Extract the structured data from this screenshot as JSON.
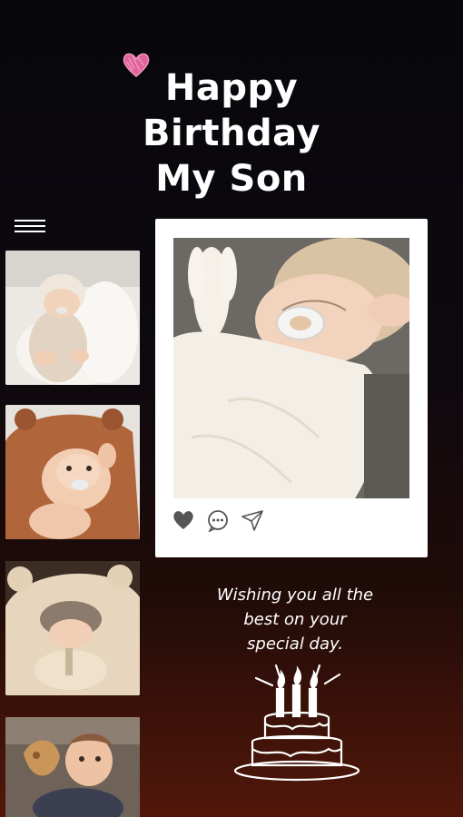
{
  "header": {
    "title_lines": [
      "Happy",
      "Birthday",
      "My Son"
    ],
    "decoration_icon": "pink-heart-icon"
  },
  "sidebar": {
    "menu_icon": "hamburger-menu-icon",
    "thumbnails": [
      {
        "icon": "baby-photo-1"
      },
      {
        "icon": "baby-photo-2"
      },
      {
        "icon": "baby-photo-3"
      },
      {
        "icon": "baby-photo-4"
      }
    ]
  },
  "post": {
    "photo_icon": "sleeping-baby-photo",
    "actions": [
      {
        "icon": "heart-icon"
      },
      {
        "icon": "comment-icon"
      },
      {
        "icon": "share-icon"
      }
    ]
  },
  "message": {
    "lines": [
      "Wishing you all the",
      "best on your",
      "special day."
    ]
  },
  "decoration": {
    "cake_icon": "birthday-cake-icon"
  },
  "colors": {
    "background_top": "#08070c",
    "background_bottom": "#52170a",
    "accent_heart": "#e0649a",
    "text": "#ffffff"
  }
}
